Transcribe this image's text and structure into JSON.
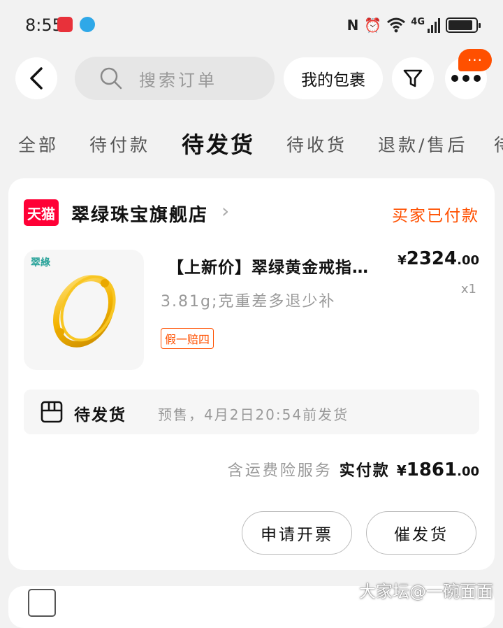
{
  "status_bar": {
    "time": "8:55",
    "network": "4G"
  },
  "top_bar": {
    "search_placeholder": "搜索订单",
    "my_packages_label": "我的包裹",
    "message_badge": "···"
  },
  "tabs": [
    {
      "label": "全部"
    },
    {
      "label": "待付款"
    },
    {
      "label": "待发货",
      "active": true
    },
    {
      "label": "待收货"
    },
    {
      "label": "退款/售后"
    },
    {
      "label": "待"
    }
  ],
  "order": {
    "platform_logo_text": "天猫",
    "store_name": "翠绿珠宝旗舰店",
    "status": "买家已付款",
    "item": {
      "image_brand_text": "翠綠",
      "title": "【上新价】翠绿黄金戒指…",
      "sku": "3.81g;克重差多退少补",
      "tag": "假一赔四",
      "price_symbol": "¥",
      "price_int": "2324",
      "price_cents": ".00",
      "quantity": "x1"
    },
    "shipping": {
      "label": "待发货",
      "description": "预售，4月2日20:54前发货"
    },
    "total": {
      "note": "含运费险服务",
      "label": "实付款",
      "symbol": "¥",
      "amount_int": "1861",
      "amount_cents": ".00"
    },
    "actions": {
      "invoice_label": "申请开票",
      "urge_label": "催发货"
    }
  },
  "watermark": "大家坛@一碗面面",
  "colors": {
    "accent": "#ff5000",
    "tmall_red": "#ff0036",
    "background": "#f2f2f2"
  }
}
